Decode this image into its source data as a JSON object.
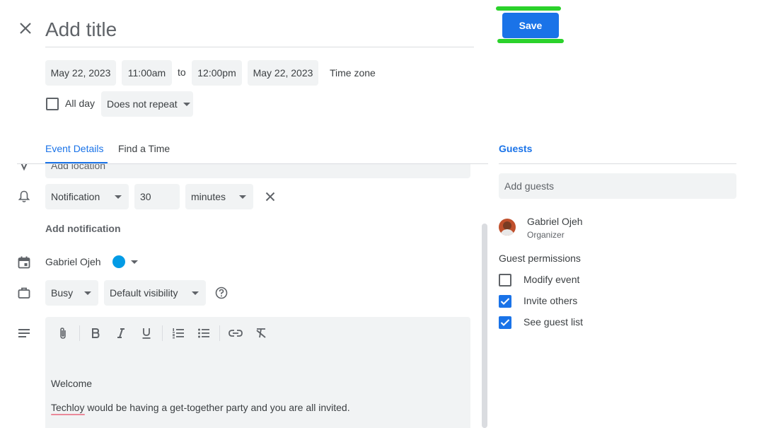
{
  "header": {
    "title_placeholder": "Add title",
    "save_label": "Save"
  },
  "datetime": {
    "start_date": "May 22, 2023",
    "start_time": "11:00am",
    "to_label": "to",
    "end_time": "12:00pm",
    "end_date": "May 22, 2023",
    "timezone_label": "Time zone"
  },
  "options": {
    "all_day_label": "All day",
    "repeat_value": "Does not repeat"
  },
  "tabs": [
    {
      "label": "Event Details",
      "active": true
    },
    {
      "label": "Find a Time",
      "active": false
    }
  ],
  "details": {
    "location_placeholder": "Add location",
    "notification_type": "Notification",
    "notification_amount": "30",
    "notification_unit": "minutes",
    "add_notification_label": "Add notification",
    "calendar_owner": "Gabriel Ojeh",
    "calendar_color": "#039be5",
    "availability": "Busy",
    "visibility": "Default visibility",
    "description_lines": [
      "Welcome",
      "Techloy would be having a get-together party and you are all invited."
    ]
  },
  "guests": {
    "tab_label": "Guests",
    "add_placeholder": "Add guests",
    "list": [
      {
        "name": "Gabriel Ojeh",
        "role": "Organizer"
      }
    ],
    "permissions_title": "Guest permissions",
    "permissions": [
      {
        "label": "Modify event",
        "checked": false
      },
      {
        "label": "Invite others",
        "checked": true
      },
      {
        "label": "See guest list",
        "checked": true
      }
    ]
  },
  "colors": {
    "accent": "#1a73e8",
    "highlight": "#2bd22b"
  }
}
